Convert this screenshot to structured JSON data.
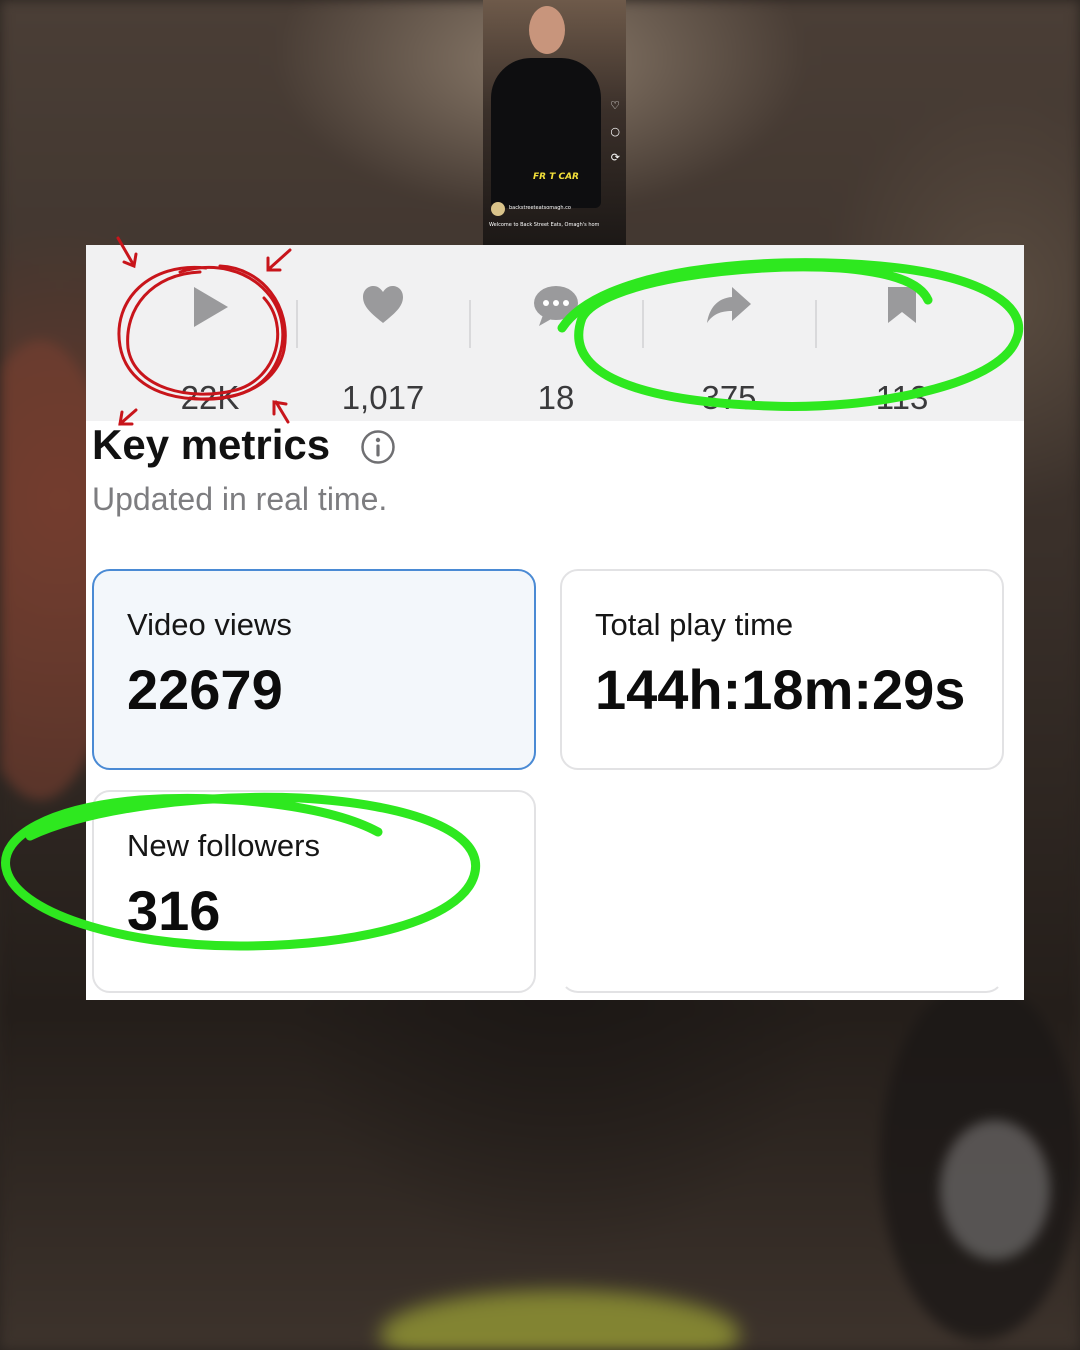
{
  "thumbnail": {
    "handle": "backstreeteatsomagh.co",
    "caption": "Welcome to Back Street Eats, Omagh's hom",
    "logo_text": "FR T CAR"
  },
  "engagement": {
    "views": "22K",
    "likes": "1,017",
    "comments": "18",
    "shares": "375",
    "saves": "113"
  },
  "key_metrics": {
    "title": "Key metrics",
    "subtitle": "Updated in real time.",
    "cards": [
      {
        "label": "Video views",
        "value": "22679"
      },
      {
        "label": "Total play time",
        "value": "144h:18m:29s"
      },
      {
        "label": "New followers",
        "value": "316"
      }
    ]
  },
  "colors": {
    "highlight_green": "#2ee81f",
    "annotation_red": "#c8151b",
    "selected_border": "#4a8ad4"
  },
  "icons": [
    "play-icon",
    "heart-icon",
    "comment-icon",
    "share-icon",
    "bookmark-icon",
    "info-icon"
  ]
}
